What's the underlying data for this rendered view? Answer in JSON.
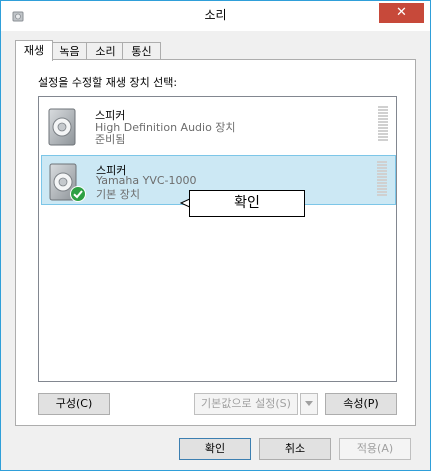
{
  "window": {
    "title": "소리",
    "close_label": "✕"
  },
  "tabs": [
    {
      "label": "재생",
      "active": true
    },
    {
      "label": "녹음",
      "active": false
    },
    {
      "label": "소리",
      "active": false
    },
    {
      "label": "통신",
      "active": false
    }
  ],
  "instruction": "설정을 수정할 재생 장치 선택:",
  "devices": [
    {
      "name": "스피커",
      "description": "High Definition Audio 장치",
      "status": "준비됨",
      "selected": false,
      "default": false
    },
    {
      "name": "스피커",
      "description": "Yamaha YVC-1000",
      "status": "기본 장치",
      "selected": true,
      "default": true
    }
  ],
  "callout": {
    "text": "확인"
  },
  "panel_buttons": {
    "configure": "구성(C)",
    "set_default": "기본값으로 설정(S)",
    "properties": "속성(P)"
  },
  "dialog_buttons": {
    "ok": "확인",
    "cancel": "취소",
    "apply": "적용(A)"
  },
  "colors": {
    "selection": "#cce8f4",
    "selection_border": "#7cc6e8",
    "close_button": "#c7493a",
    "check": "#2ea043",
    "window_border": "#2f9fd9"
  }
}
